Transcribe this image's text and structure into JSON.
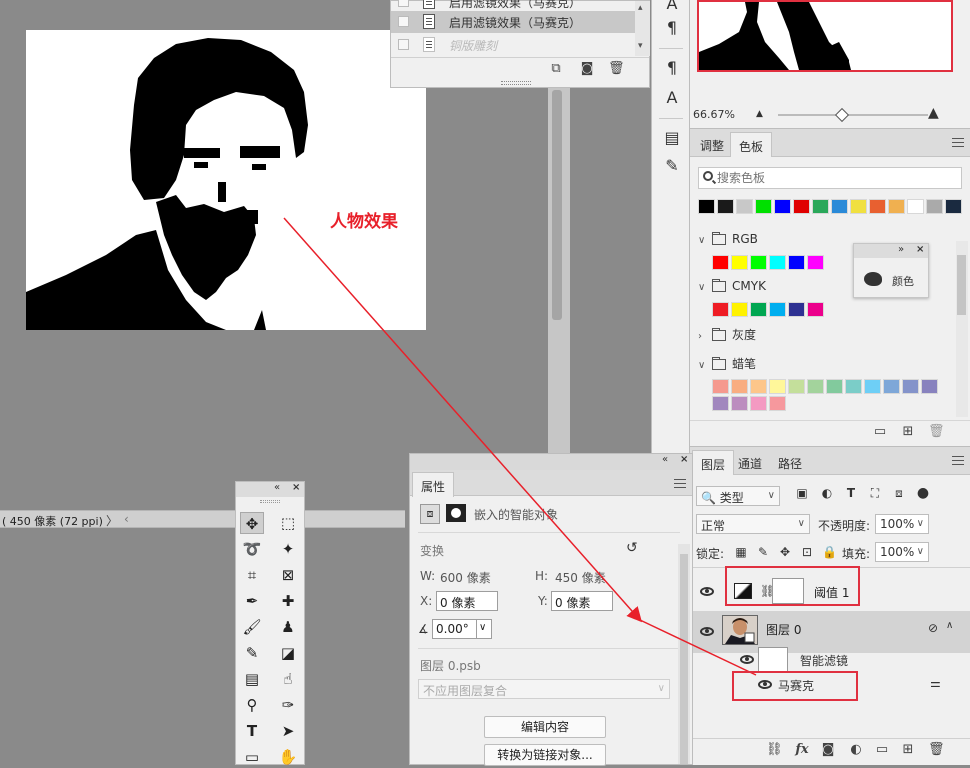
{
  "canvas": {
    "annotation_text": "人物效果",
    "status_text": "( 450 像素 (72 ppi)"
  },
  "history": {
    "items": [
      {
        "label": "启用滤镜效果（马赛克）"
      },
      {
        "label": "启用滤镜效果（马赛克）"
      },
      {
        "label": "铜版雕刻"
      }
    ]
  },
  "navigator": {
    "zoom": "66.67%"
  },
  "swatches": {
    "tabs": [
      "调整",
      "色板"
    ],
    "active_tab": "色板",
    "search_placeholder": "搜索色板",
    "recent_colors": [
      "#000000",
      "#1a1a1a",
      "#c8c8c8",
      "#00e000",
      "#0000ff",
      "#e00000",
      "#2aa85a",
      "#2a8ad8",
      "#f0e040",
      "#e86030",
      "#f0b050",
      "#ffffff",
      "#aaaaaa",
      "#1a2a40"
    ],
    "groups": [
      {
        "name": "RGB",
        "colors": [
          "#ff0000",
          "#ffff00",
          "#00ff00",
          "#00ffff",
          "#0000ff",
          "#ff00ff"
        ]
      },
      {
        "name": "CMYK",
        "colors": [
          "#ee1c24",
          "#fff200",
          "#00a651",
          "#00aeef",
          "#2e3192",
          "#ec008c"
        ]
      },
      {
        "name": "灰度",
        "colors": []
      },
      {
        "name": "蜡笔",
        "colors": [
          "#f5998e",
          "#f9ad81",
          "#fdc68a",
          "#fff79a",
          "#c4df9b",
          "#a3d39c",
          "#82ca9d",
          "#7bcdc8",
          "#6ecff6",
          "#7ea7d8",
          "#8493ca",
          "#8882be",
          "#a187be",
          "#bc8dbf",
          "#f49ac2",
          "#f6989d"
        ]
      }
    ],
    "popup_label": "颜色"
  },
  "layers": {
    "tabs": [
      "图层",
      "通道",
      "路径"
    ],
    "active_tab": "图层",
    "filter_kind": "类型",
    "blend_mode": "正常",
    "opacity_label": "不透明度:",
    "opacity_value": "100%",
    "lock_label": "锁定:",
    "fill_label": "填充:",
    "fill_value": "100%",
    "items": [
      {
        "name": "阈值 1"
      },
      {
        "name": "图层 0"
      },
      {
        "name": "智能滤镜"
      },
      {
        "name": "马赛克"
      }
    ]
  },
  "properties": {
    "tab": "属性",
    "kind_label": "嵌入的智能对象",
    "section_transform": "变换",
    "w_label": "W:",
    "w_value": "600 像素",
    "h_label": "H:",
    "h_value": "450 像素",
    "x_label": "X:",
    "x_value": "0 像素",
    "y_label": "Y:",
    "y_value": "0 像素",
    "angle_value": "0.00°",
    "file_name": "图层 0.psb",
    "comp_placeholder": "不应用图层复合",
    "edit_button": "编辑内容",
    "convert_button": "转换为链接对象..."
  },
  "tools": {
    "items": [
      "move",
      "marquee",
      "lasso",
      "magic-wand",
      "crop",
      "frame",
      "eyedropper",
      "healing",
      "brush",
      "stamp",
      "history-brush",
      "eraser",
      "gradient",
      "smudge",
      "dodge",
      "pen",
      "type",
      "path-select",
      "rectangle",
      "hand"
    ]
  },
  "colors": {
    "annotation": "#e8202a",
    "highlight_border": "#e03040"
  }
}
